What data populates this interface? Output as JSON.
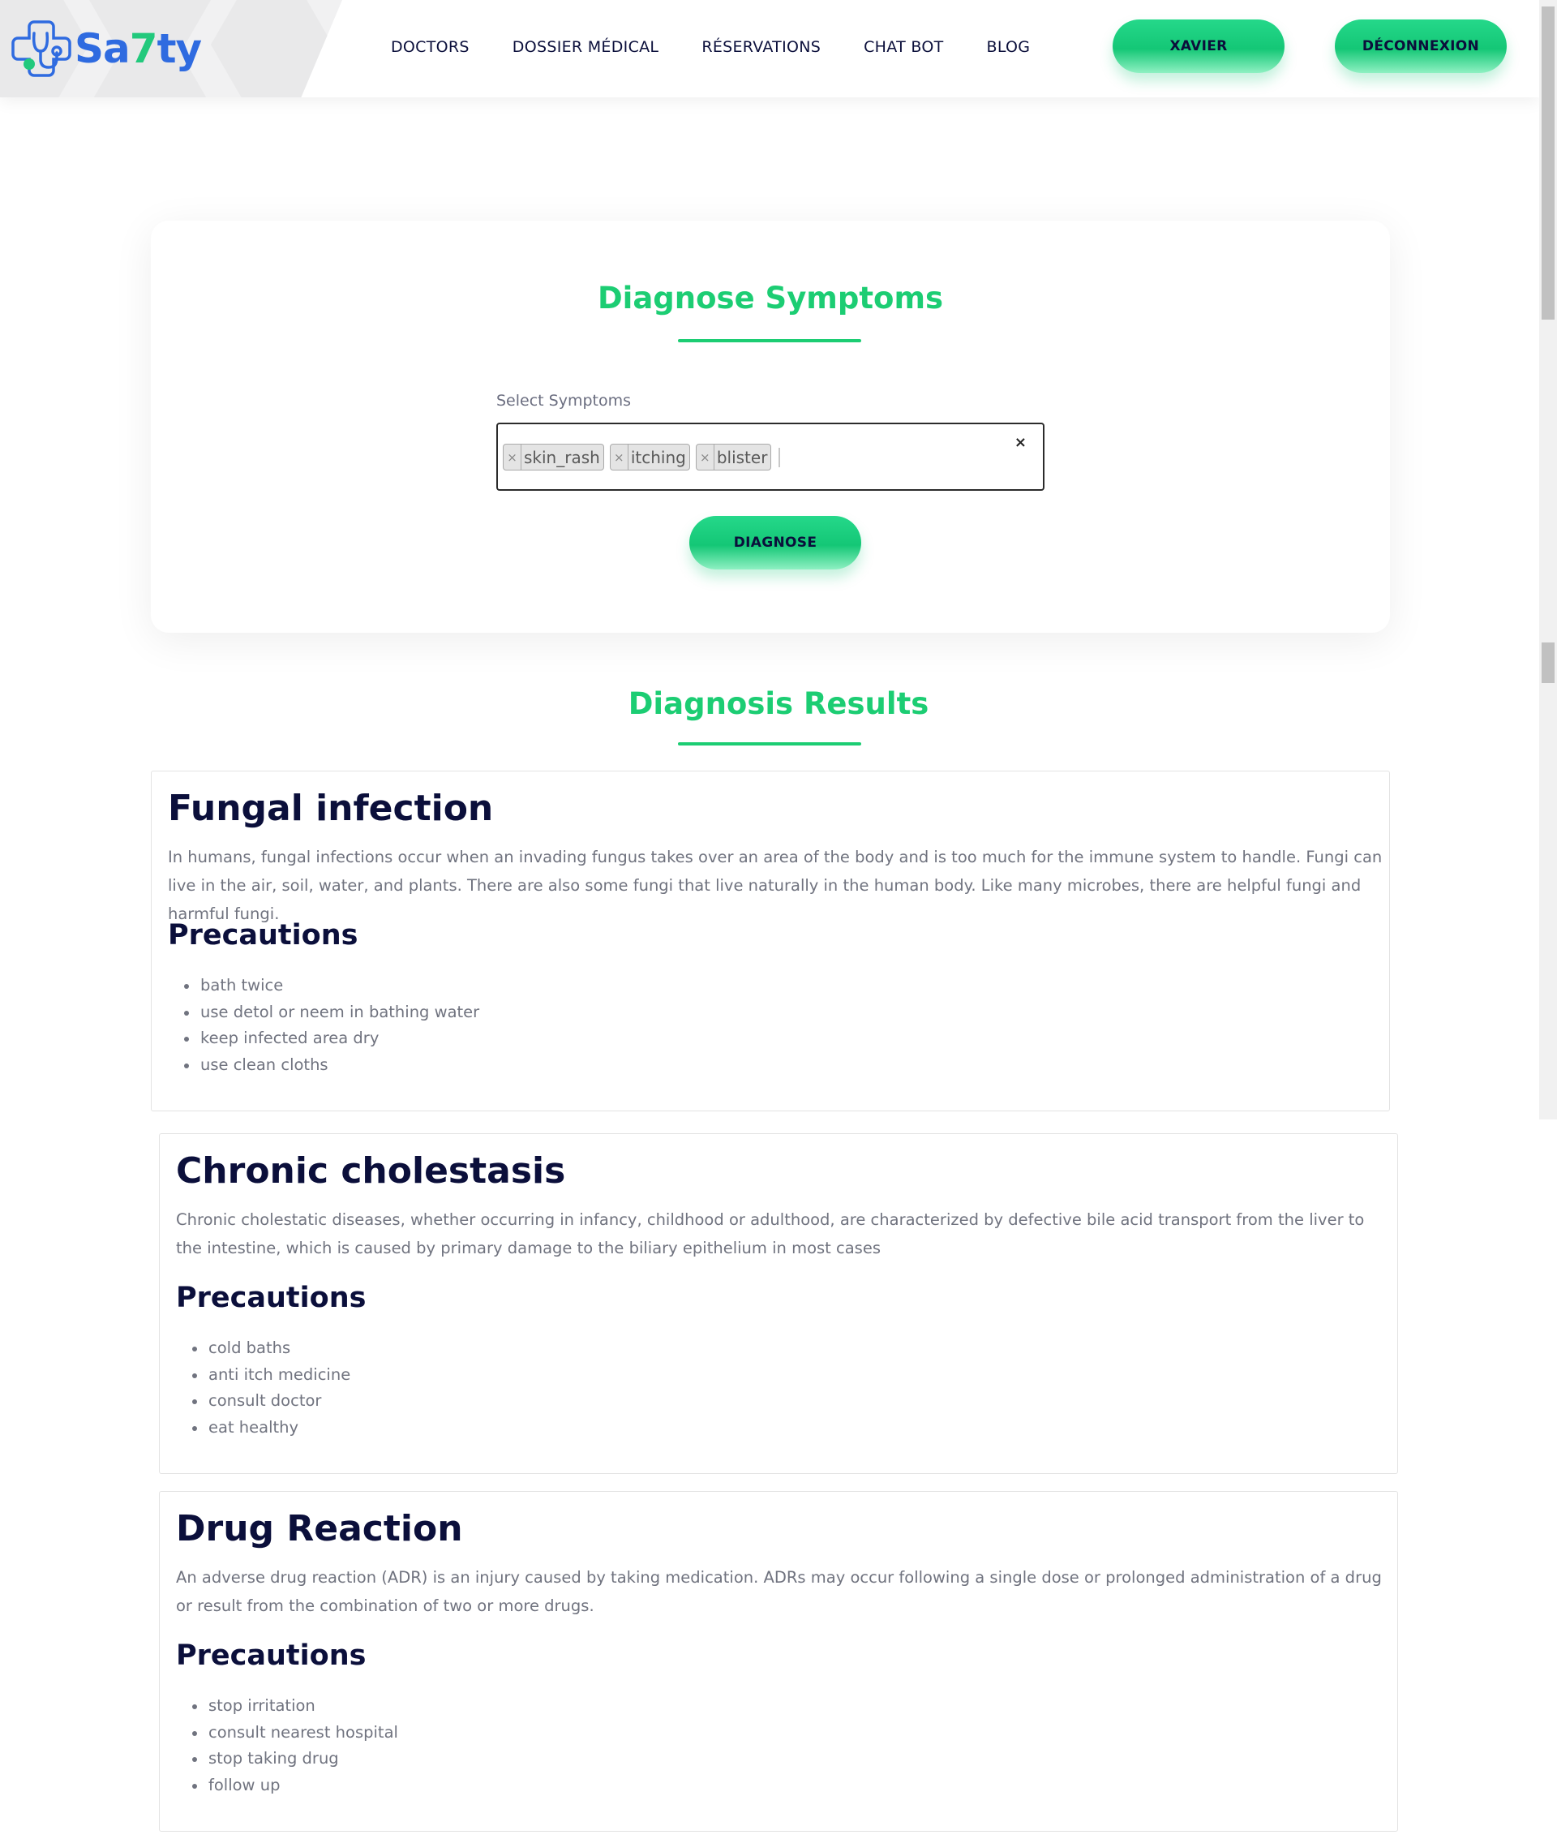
{
  "brand": {
    "logo_prefix": "Sa",
    "logo_seven": "7",
    "logo_suffix": "ty"
  },
  "nav": {
    "items": [
      {
        "label": "DOCTORS"
      },
      {
        "label": "DOSSIER MÉDICAL"
      },
      {
        "label": "RÉSERVATIONS"
      },
      {
        "label": "CHAT BOT"
      },
      {
        "label": "BLOG"
      }
    ],
    "user_button": "XAVIER",
    "logout_button": "DÉCONNEXION"
  },
  "diagnose": {
    "title": "Diagnose Symptoms",
    "field_label": "Select Symptoms",
    "selected": [
      {
        "remove": "×",
        "label": "skin_rash"
      },
      {
        "remove": "×",
        "label": "itching"
      },
      {
        "remove": "×",
        "label": "blister"
      }
    ],
    "clear_label": "×",
    "button_label": "DIAGNOSE"
  },
  "results": {
    "title": "Diagnosis Results",
    "precautions_heading": "Precautions",
    "items": [
      {
        "name": "Fungal infection",
        "description": "In humans, fungal infections occur when an invading fungus takes over an area of the body and is too much for the immune system to handle. Fungi can live in the air, soil, water, and plants. There are also some fungi that live naturally in the human body. Like many microbes, there are helpful fungi and harmful fungi.",
        "precautions": [
          "bath twice",
          "use detol or neem in bathing water",
          "keep infected area dry",
          "use clean cloths"
        ]
      },
      {
        "name": "Chronic cholestasis",
        "description": "Chronic cholestatic diseases, whether occurring in infancy, childhood or adulthood, are characterized by defective bile acid transport from the liver to the intestine, which is caused by primary damage to the biliary epithelium in most cases",
        "precautions": [
          "cold baths",
          "anti itch medicine",
          "consult doctor",
          "eat healthy"
        ]
      },
      {
        "name": "Drug Reaction",
        "description": "An adverse drug reaction (ADR) is an injury caused by taking medication. ADRs may occur following a single dose or prolonged administration of a drug or result from the combination of two or more drugs.",
        "precautions": [
          "stop irritation",
          "consult nearest hospital",
          "stop taking drug",
          "follow up"
        ]
      }
    ]
  },
  "colors": {
    "accent_green": "#1ccd73",
    "brand_blue": "#2f6be0",
    "heading_navy": "#0b0f3b",
    "body_gray": "#70737f"
  }
}
